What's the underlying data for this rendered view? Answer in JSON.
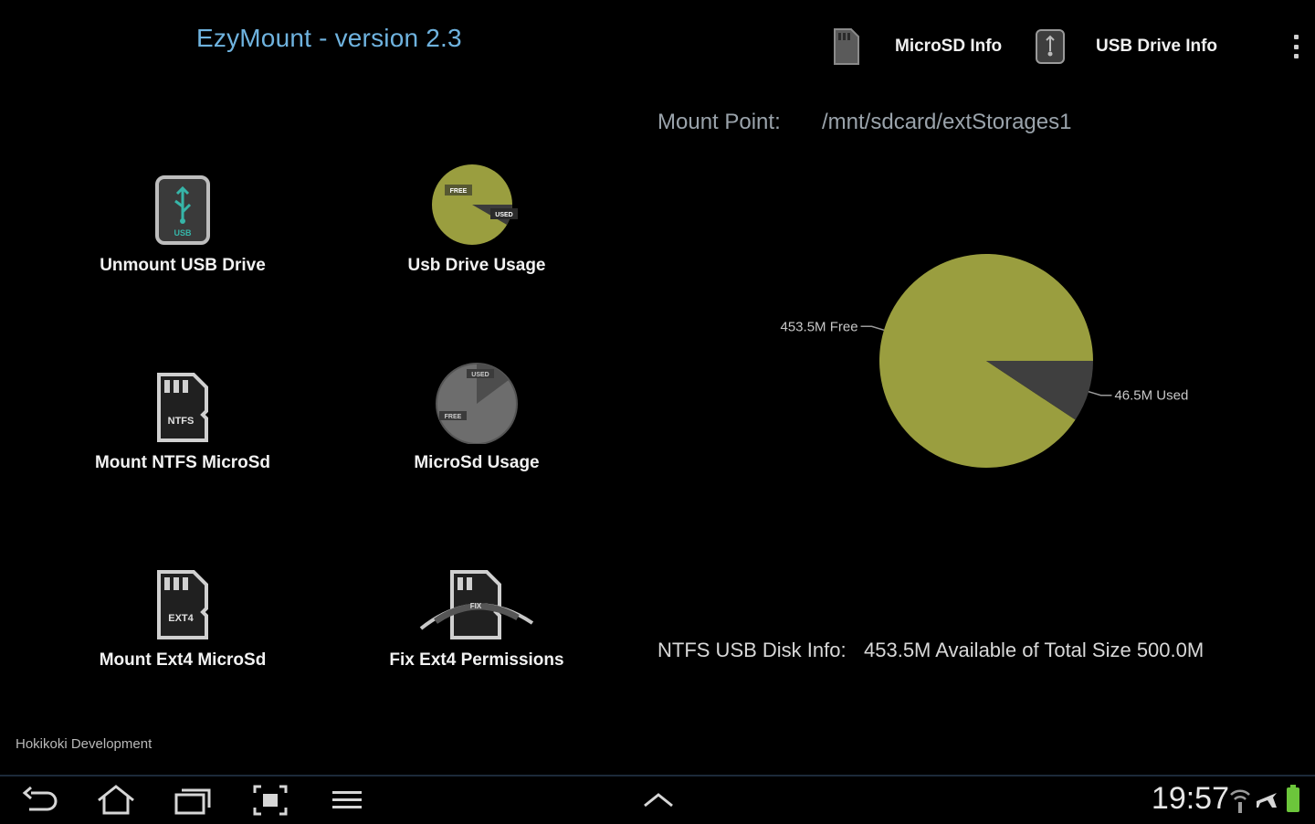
{
  "app": {
    "title": "EzyMount - version 2.3"
  },
  "action_bar": {
    "microsd_info_label": "MicroSD Info",
    "usb_drive_info_label": "USB Drive Info",
    "icons": [
      "sd-card-icon",
      "usb-drive-icon",
      "overflow-menu-icon"
    ]
  },
  "grid": {
    "items": [
      {
        "label": "Unmount USB Drive",
        "icon": "usb-drive-icon",
        "icon_text": "USB"
      },
      {
        "label": "Usb Drive Usage",
        "icon": "usage-pie-icon",
        "icon_text_1": "FREE",
        "icon_text_2": "USED"
      },
      {
        "label": "Mount NTFS MicroSd",
        "icon": "microsd-card-icon",
        "icon_text": "NTFS"
      },
      {
        "label": "MicroSd Usage",
        "icon": "usage-pie-icon",
        "icon_text_1": "USED",
        "icon_text_2": "FREE"
      },
      {
        "label": "Mount Ext4 MicroSd",
        "icon": "microsd-card-icon",
        "icon_text": "EXT4"
      },
      {
        "label": "Fix Ext4 Permissions",
        "icon": "fix-permissions-icon",
        "icon_text": "FIX"
      }
    ]
  },
  "footer": {
    "credit": "Hokikoki Development"
  },
  "details": {
    "mount_point_label": "Mount Point:",
    "mount_point_value": "/mnt/sdcard/extStorages1",
    "disk_info_label": "NTFS USB Disk Info:",
    "disk_info_value": "453.5M Available of Total Size 500.0M"
  },
  "chart_data": {
    "type": "pie",
    "slices": [
      {
        "label": "453.5M Free",
        "value": 453.5,
        "color": "#9a9e3f"
      },
      {
        "label": "46.5M Used",
        "value": 46.5,
        "color": "#3f3f3f"
      }
    ],
    "start_angle_deg": 0,
    "direction": "clockwise"
  },
  "system_bar": {
    "clock": "19:57",
    "icons": [
      "back-icon",
      "home-icon",
      "recent-apps-icon",
      "screenshot-icon",
      "menu-icon",
      "chevron-up-icon",
      "wifi-icon",
      "airplane-mode-icon",
      "battery-icon"
    ]
  },
  "colors": {
    "title": "#6fb3df",
    "pie_free": "#9a9e3f",
    "pie_used": "#3f3f3f",
    "battery": "#6cc63b"
  }
}
